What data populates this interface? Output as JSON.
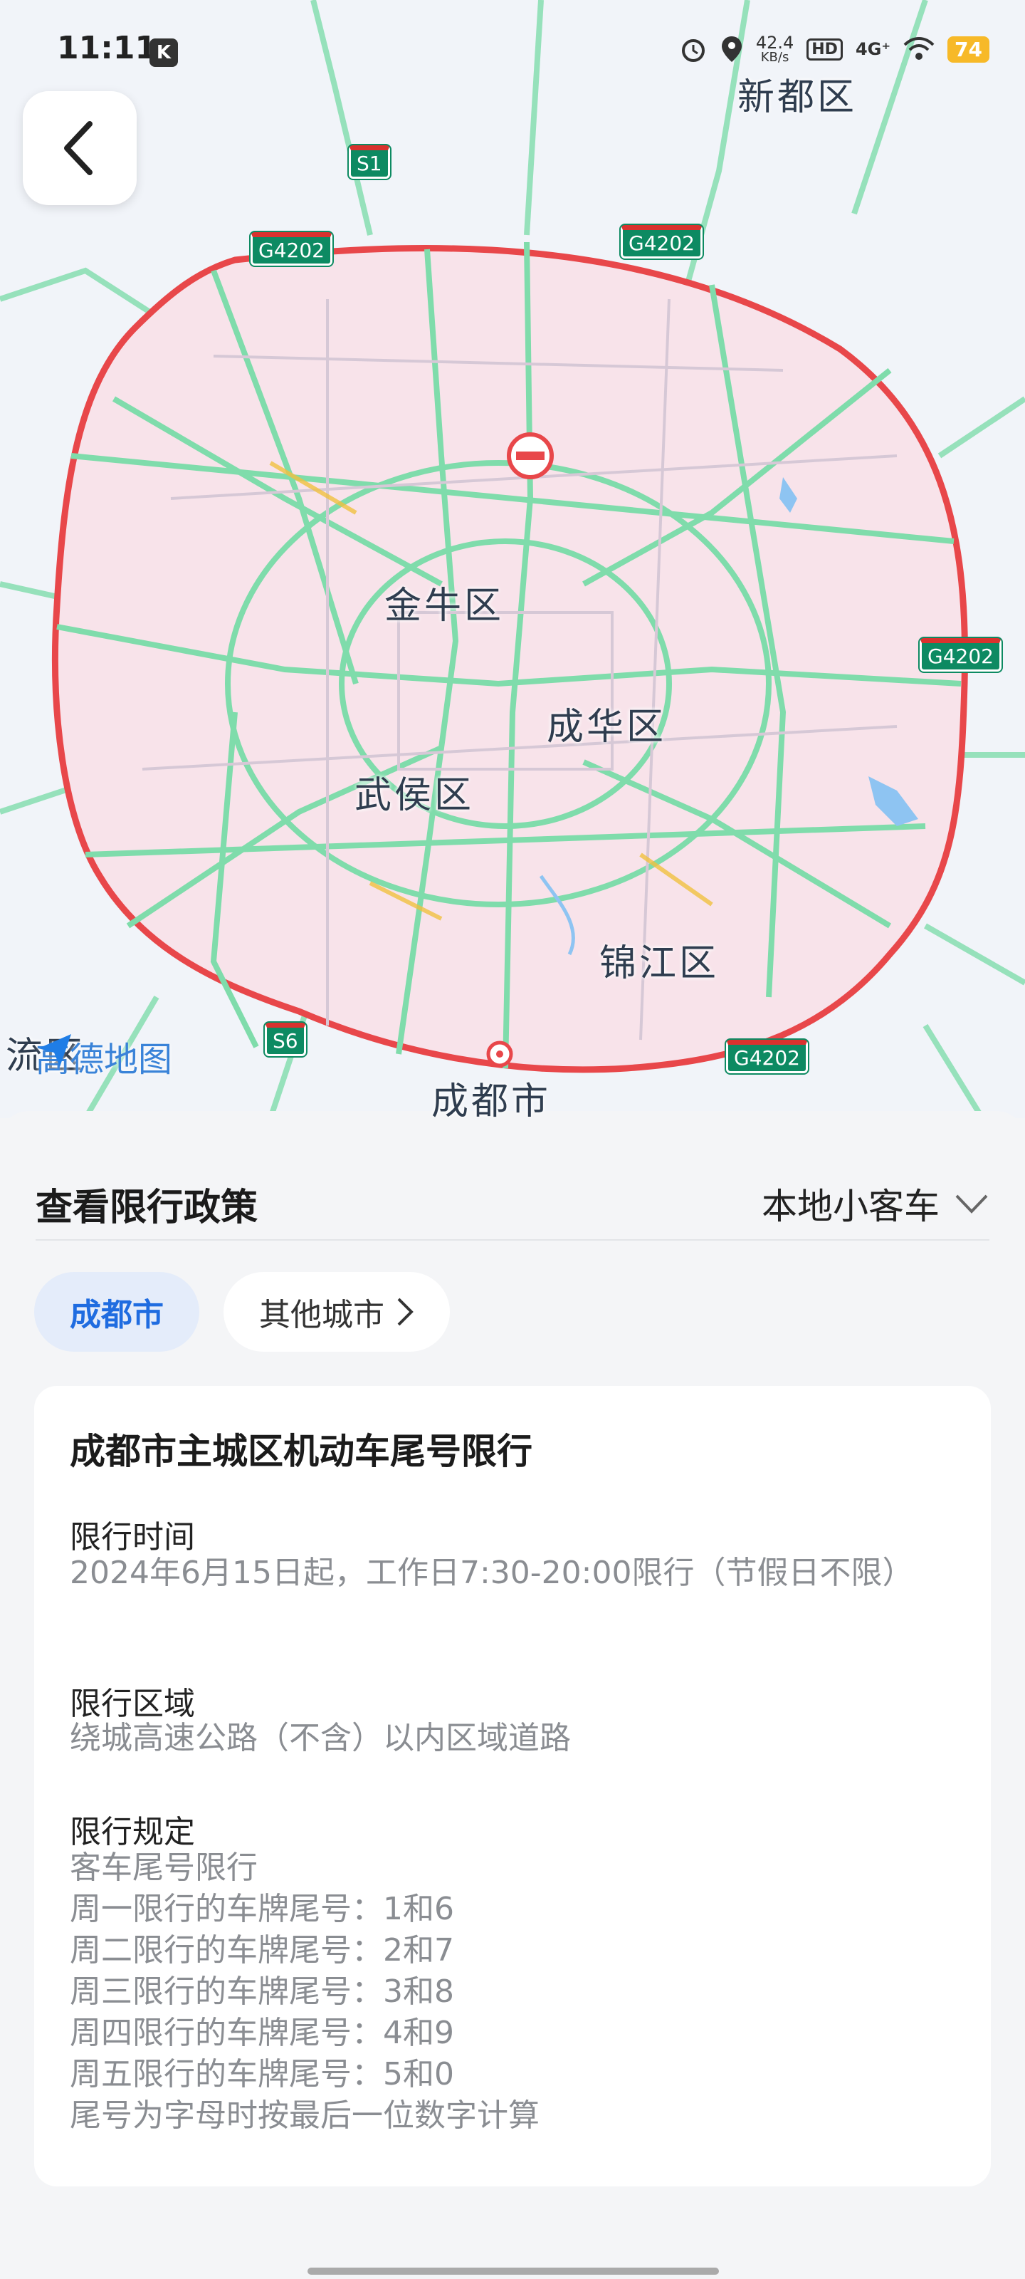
{
  "status_bar": {
    "time": "11:11",
    "app_badge": "K",
    "net_speed_value": "42.4",
    "net_speed_unit": "KB/s",
    "hd_label": "HD",
    "network": "4G⁺",
    "battery": "74"
  },
  "map": {
    "districts": {
      "xindu": "新都区",
      "jinniu": "金牛区",
      "chenghua": "成华区",
      "wuhou": "武侯区",
      "jinjiang": "锦江区",
      "city": "成都市",
      "left_edge": "流区"
    },
    "road_shields": {
      "s1": "S1",
      "s6": "S6",
      "g4202_a": "G4202",
      "g4202_b": "G4202",
      "g4202_c": "G4202",
      "g4202_d": "G4202"
    },
    "logo": "高德地图",
    "colors": {
      "restricted_fill": "#f8e3ea",
      "restricted_border": "#e8474a",
      "road_green": "#6fd4a0"
    }
  },
  "panel": {
    "title": "查看限行政策",
    "vehicle_type": "本地小客车",
    "city_chips": {
      "current": "成都市",
      "other": "其他城市"
    },
    "card": {
      "title": "成都市主城区机动车尾号限行",
      "time_label": "限行时间",
      "time_text": "2024年6月15日起，工作日7:30-20:00限行（节假日不限）",
      "area_label": "限行区域",
      "area_text": "绕城高速公路（不含）以内区域道路",
      "rule_label": "限行规定",
      "rules": [
        "客车尾号限行",
        "周一限行的车牌尾号：1和6",
        "周二限行的车牌尾号：2和7",
        "周三限行的车牌尾号：3和8",
        "周四限行的车牌尾号：4和9",
        "周五限行的车牌尾号：5和0",
        "尾号为字母时按最后一位数字计算"
      ]
    }
  }
}
